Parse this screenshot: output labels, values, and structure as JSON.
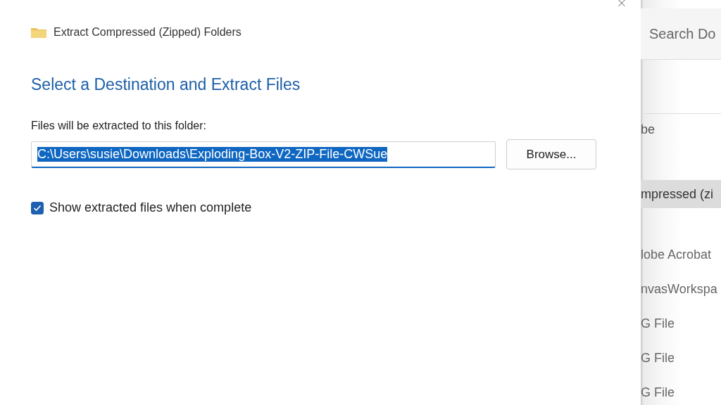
{
  "window": {
    "title": "Extract Compressed (Zipped) Folders"
  },
  "heading": "Select a Destination and Extract Files",
  "destination": {
    "label": "Files will be extracted to this folder:",
    "value": "C:\\Users\\susie\\Downloads\\Exploding-Box-V2-ZIP-File-CWSue",
    "selected": true
  },
  "browse_button": "Browse...",
  "show_files": {
    "label": "Show extracted files when complete",
    "checked": true
  },
  "background_window": {
    "search": {
      "placeholder": "Search Do"
    },
    "items": [
      {
        "label": "be",
        "selected": false
      },
      {
        "label": "mpressed (zi",
        "selected": true
      },
      {
        "label": "lobe Acrobat",
        "selected": false
      },
      {
        "label": "nvasWorkspa",
        "selected": false
      },
      {
        "label": "G File",
        "selected": false
      },
      {
        "label": "G File",
        "selected": false
      },
      {
        "label": "G File",
        "selected": false
      }
    ]
  }
}
